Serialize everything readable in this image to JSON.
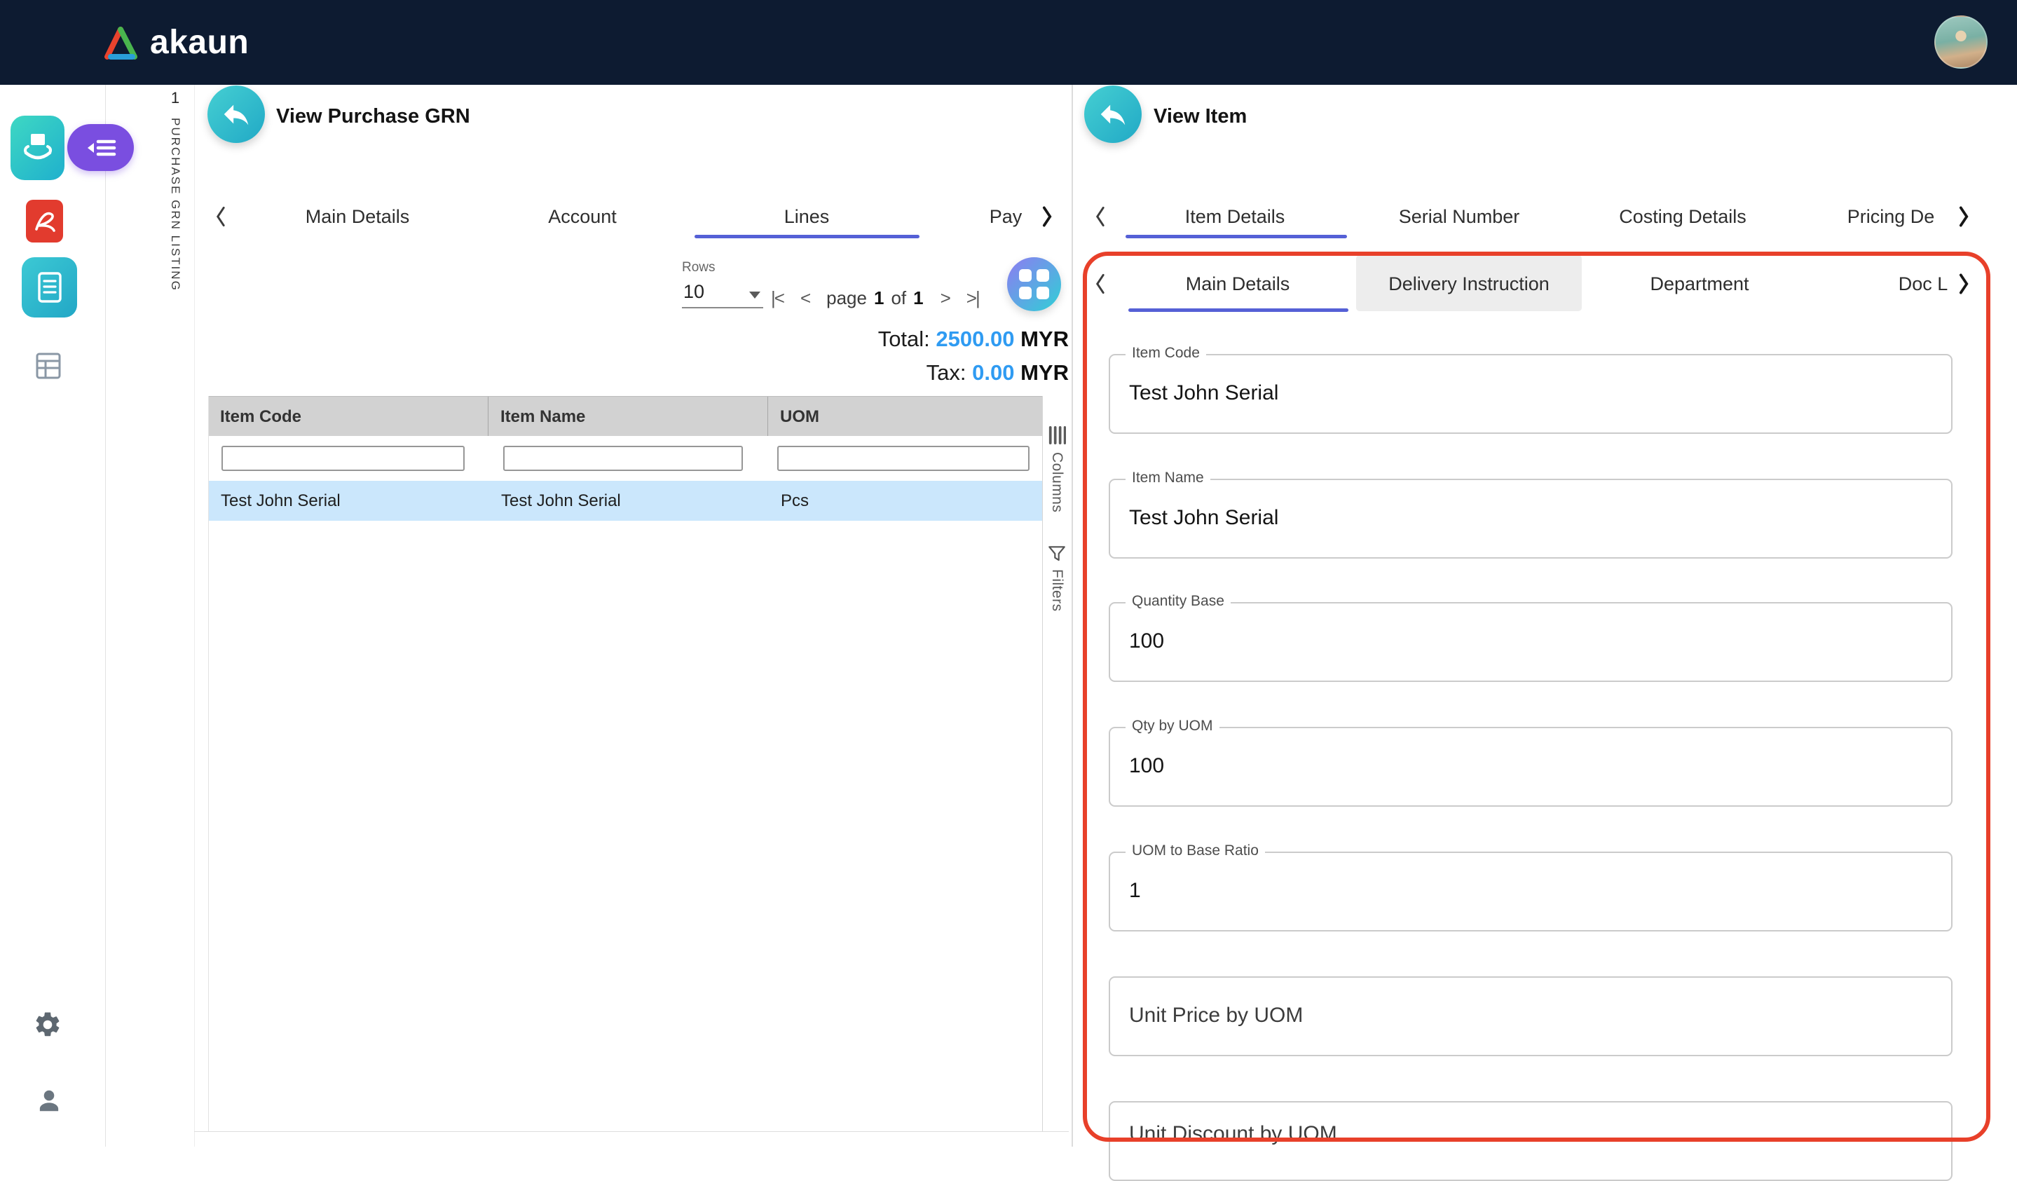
{
  "colors": {
    "topbar": "#0d1b31",
    "accent_teal": "#2bb6c9",
    "accent_purple": "#7a4ee0",
    "tab_underline": "#5560d6",
    "amount_blue": "#2f9bf2",
    "row_highlight": "#cbe7fc",
    "annotation_red": "#e8402a",
    "pdf_red": "#e23b2e"
  },
  "icons": {
    "brand": "triangle-logo",
    "module": "hands-box",
    "collapse": "menu-indent",
    "pdf": "acrobat-swirl",
    "listing": "form-lines",
    "grid_table": "table-grid",
    "settings": "gear",
    "profile": "person",
    "back": "reply-arrow",
    "layout": "dashboard-grid",
    "columns": "column-bars",
    "filters": "funnel"
  },
  "topbar": {
    "brand": "akaun"
  },
  "strip": {
    "index": "1",
    "label": "PURCHASE GRN LISTING"
  },
  "left_panel": {
    "title": "View Purchase GRN",
    "tabs": [
      "Main Details",
      "Account",
      "Lines",
      "Pay"
    ],
    "active_tab": "Lines",
    "rows_label": "Rows",
    "rows_value": "10",
    "pagination": {
      "first": "|<",
      "prev": "<",
      "page_word": "page",
      "current": "1",
      "of_word": "of",
      "total": "1",
      "next": ">",
      "last": ">|"
    },
    "totals": {
      "total_label": "Total:",
      "total_value": "2500.00",
      "total_currency": "MYR",
      "tax_label": "Tax:",
      "tax_value": "0.00",
      "tax_currency": "MYR"
    },
    "table": {
      "columns": [
        "Item Code",
        "Item Name",
        "UOM"
      ],
      "filters": [
        "",
        "",
        ""
      ],
      "rows": [
        [
          "Test John Serial",
          "Test John Serial",
          "Pcs"
        ]
      ]
    },
    "side_tools": {
      "columns_label": "Columns",
      "filters_label": "Filters"
    }
  },
  "right_panel": {
    "title": "View Item",
    "tabs": [
      "Item Details",
      "Serial Number",
      "Costing Details",
      "Pricing De"
    ],
    "active_tab": "Item Details",
    "subtabs": [
      "Main Details",
      "Delivery Instruction",
      "Department",
      "Doc L"
    ],
    "active_subtab": "Main Details",
    "fields": [
      {
        "label": "Item Code",
        "value": "Test John Serial"
      },
      {
        "label": "Item Name",
        "value": "Test John Serial"
      },
      {
        "label": "Quantity Base",
        "value": "100"
      },
      {
        "label": "Qty by UOM",
        "value": "100"
      },
      {
        "label": "UOM to Base Ratio",
        "value": "1"
      },
      {
        "label": "Unit Price by UOM",
        "value": ""
      },
      {
        "label": "Unit Discount by UOM",
        "value": ""
      }
    ]
  }
}
